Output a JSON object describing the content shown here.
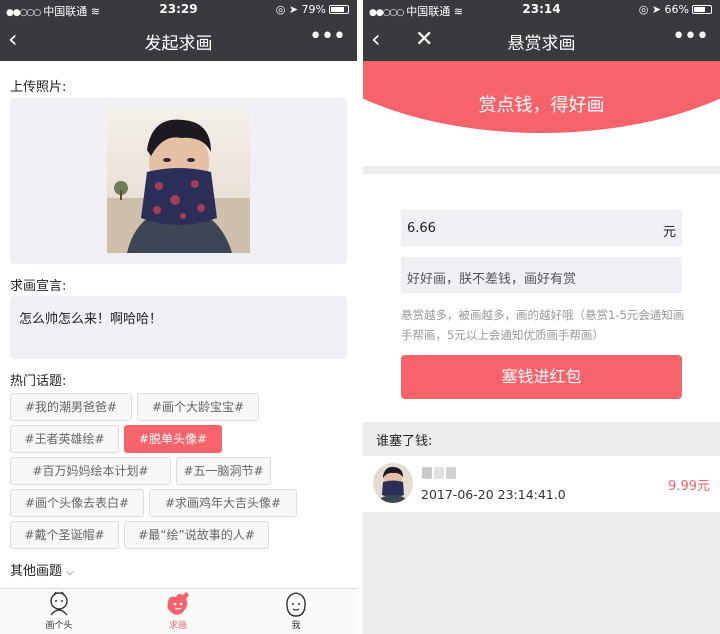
{
  "left": {
    "status": {
      "carrier": "中国联通",
      "time": "23:29",
      "battery": "79%",
      "battery_level": 0.79
    },
    "nav": {
      "title": "发起求画"
    },
    "upload_label": "上传照片:",
    "declaration_label": "求画宣言:",
    "declaration_text": "怎么帅怎么来！啊哈哈！",
    "topics_label": "热门话题:",
    "topics": [
      {
        "label": "#我的潮男爸爸#",
        "selected": false
      },
      {
        "label": "#画个大龄宝宝#",
        "selected": false
      },
      {
        "label": "#王者英雄绘#",
        "selected": false
      },
      {
        "label": "#脱单头像#",
        "selected": true
      },
      {
        "label": "#百万妈妈绘本计划#",
        "selected": false
      },
      {
        "label": "#五一脑洞节#",
        "selected": false
      },
      {
        "label": "#画个头像去表白#",
        "selected": false
      },
      {
        "label": "#求画鸡年大吉头像#",
        "selected": false
      },
      {
        "label": "#戴个圣诞帽#",
        "selected": false
      },
      {
        "label": "#最“绘”说故事的人#",
        "selected": false
      }
    ],
    "other_topics": "其他画题",
    "tabs": [
      {
        "label": "画个头",
        "icon": "draw-avatar-icon",
        "active": false
      },
      {
        "label": "求画",
        "icon": "request-drawing-icon",
        "active": true
      },
      {
        "label": "我",
        "icon": "me-icon",
        "active": false
      }
    ]
  },
  "right": {
    "status": {
      "carrier": "中国联通",
      "time": "23:14",
      "battery": "66%",
      "battery_level": 0.66
    },
    "nav": {
      "title": "悬赏求画"
    },
    "banner": "赏点钱，得好画",
    "amount": {
      "value": "6.66",
      "unit": "元"
    },
    "message_placeholder": "好好画，朕不差钱，画好有赏",
    "hint": "悬赏越多，被画越多，画的越好哦（悬赏1-5元会通知画手帮画，5元以上会通知优质画手帮画）",
    "pay_button": "塞钱进红包",
    "payers_label": "谁塞了钱:",
    "payers": [
      {
        "time": "2017-06-20 23:14:41.0",
        "amount": "9.99元"
      }
    ]
  },
  "colors": {
    "accent": "#f6636a",
    "navbar": "#393a3e",
    "field": "#efeff4"
  }
}
